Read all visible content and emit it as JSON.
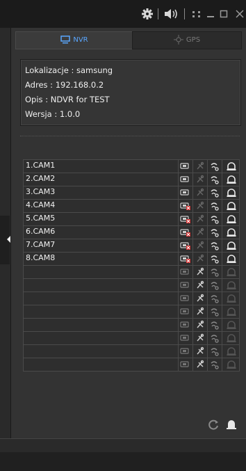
{
  "tabs": {
    "nvr": "NVR",
    "gps": "GPS"
  },
  "info": {
    "location": "Lokalizacje : samsung",
    "address": "Adres : 192.168.0.2",
    "description": "Opis : NDVR for TEST",
    "version": "Wersja : 1.0.0"
  },
  "cameras": [
    {
      "name": "1.CAM1",
      "connected": true
    },
    {
      "name": "2.CAM2",
      "connected": true
    },
    {
      "name": "3.CAM3",
      "connected": true
    },
    {
      "name": "4.CAM4",
      "connected": false
    },
    {
      "name": "5.CAM5",
      "connected": false
    },
    {
      "name": "6.CAM6",
      "connected": false
    },
    {
      "name": "7.CAM7",
      "connected": false
    },
    {
      "name": "8.CAM8",
      "connected": false
    },
    {
      "name": "",
      "connected": null
    },
    {
      "name": "",
      "connected": null
    },
    {
      "name": "",
      "connected": null
    },
    {
      "name": "",
      "connected": null
    },
    {
      "name": "",
      "connected": null
    },
    {
      "name": "",
      "connected": null
    },
    {
      "name": "",
      "connected": null
    },
    {
      "name": "",
      "connected": null
    }
  ],
  "colors": {
    "accent": "#5aa7ff",
    "error": "#d22c2c",
    "background": "#2a2a2a"
  }
}
